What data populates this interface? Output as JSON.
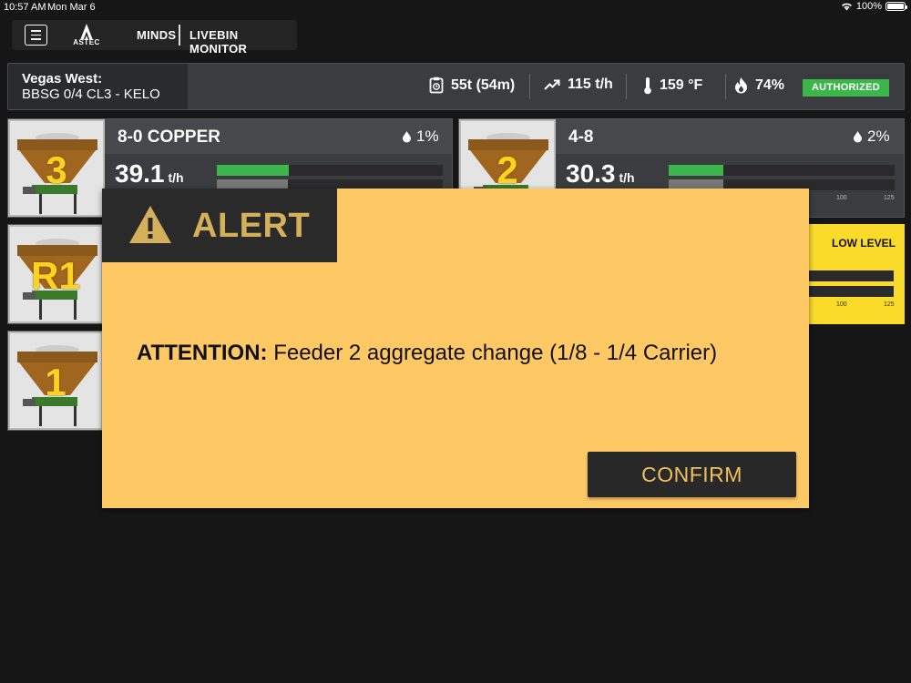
{
  "status_bar": {
    "time": "10:57 AM",
    "date": "Mon Mar 6",
    "battery": "100%"
  },
  "app": {
    "logo_text": "ASTEC",
    "brand": "MINDS",
    "module": "LIVEBIN MONITOR"
  },
  "info": {
    "site_name": "Vegas West:",
    "mix": "BBSG 0/4 CL3 - KELO",
    "tonnage": "55t (54m)",
    "rate": "115 t/h",
    "temperature": "159 °F",
    "burner": "74%",
    "status": "AUTHORIZED",
    "status_color": "#3cb54a"
  },
  "bins": [
    {
      "number": "3",
      "name": "8-0 COPPER",
      "moisture": "1%",
      "rate": "39.1",
      "unit": "t/h",
      "fill_fraction": 0.32
    },
    {
      "number": "2",
      "name": "4-8",
      "moisture": "2%",
      "rate": "30.3",
      "unit": "t/h",
      "fill_fraction": 0.24,
      "ticks": [
        "100",
        "125"
      ]
    },
    {
      "number": "R1"
    },
    {
      "number": "1"
    }
  ],
  "low_level_card": {
    "label": "LOW LEVEL",
    "ticks": [
      "100",
      "125"
    ],
    "color": "#fbdb2a"
  },
  "alert": {
    "title": "ALERT",
    "icon": "warning-triangle-icon",
    "message_prefix": "ATTENTION:",
    "message": "Feeder 2 aggregate change (1/8 - 1/4 Carrier)",
    "confirm_label": "CONFIRM",
    "background": "#fec864"
  }
}
